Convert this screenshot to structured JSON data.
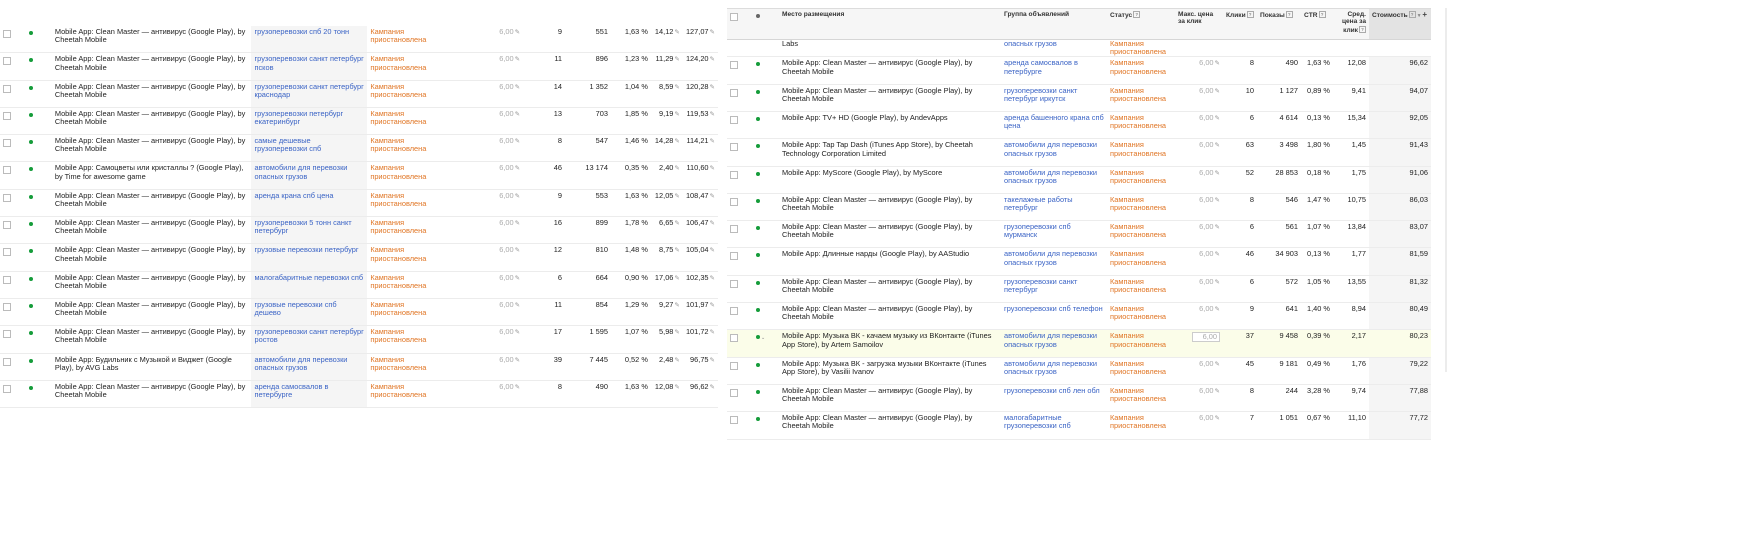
{
  "status_text": "Кампания приостановлена",
  "bid_value": "6,00",
  "right_headers": {
    "placement": "Место размещения",
    "ad_group": "Группа объявлений",
    "status": "Статус",
    "max_cpc": "Макс. цена за клик",
    "clicks": "Клики",
    "impressions": "Показы",
    "ctr": "CTR",
    "avg_cpc": "Сред. цена за клик",
    "cost": "Стоимость"
  },
  "right_partial_row": {
    "placement": "Labs",
    "ad_group": "опасных грузов"
  },
  "left_rows": [
    {
      "placement": "Mobile App: Clean Master — антивирус (Google Play), by Cheetah Mobile",
      "ad_group": "грузоперевозки спб 20 тонн",
      "clicks": "9",
      "impressions": "551",
      "ctr": "1,63 %",
      "avg_cpc": "14,12",
      "cost": "127,07"
    },
    {
      "placement": "Mobile App: Clean Master — антивирус (Google Play), by Cheetah Mobile",
      "ad_group": "грузоперевозки санкт петербург псков",
      "clicks": "11",
      "impressions": "896",
      "ctr": "1,23 %",
      "avg_cpc": "11,29",
      "cost": "124,20"
    },
    {
      "placement": "Mobile App: Clean Master — антивирус (Google Play), by Cheetah Mobile",
      "ad_group": "грузоперевозки санкт петербург краснодар",
      "clicks": "14",
      "impressions": "1 352",
      "ctr": "1,04 %",
      "avg_cpc": "8,59",
      "cost": "120,28"
    },
    {
      "placement": "Mobile App: Clean Master — антивирус (Google Play), by Cheetah Mobile",
      "ad_group": "грузоперевозки петербург екатеринбург",
      "clicks": "13",
      "impressions": "703",
      "ctr": "1,85 %",
      "avg_cpc": "9,19",
      "cost": "119,53"
    },
    {
      "placement": "Mobile App: Clean Master — антивирус (Google Play), by Cheetah Mobile",
      "ad_group": "самые дешевые грузоперевозки спб",
      "clicks": "8",
      "impressions": "547",
      "ctr": "1,46 %",
      "avg_cpc": "14,28",
      "cost": "114,21"
    },
    {
      "placement": "Mobile App: Самоцветы или кристаллы ? (Google Play), by Time for awesome game",
      "ad_group": "автомобили для перевозки опасных грузов",
      "clicks": "46",
      "impressions": "13 174",
      "ctr": "0,35 %",
      "avg_cpc": "2,40",
      "cost": "110,60"
    },
    {
      "placement": "Mobile App: Clean Master — антивирус (Google Play), by Cheetah Mobile",
      "ad_group": "аренда крана спб цена",
      "clicks": "9",
      "impressions": "553",
      "ctr": "1,63 %",
      "avg_cpc": "12,05",
      "cost": "108,47"
    },
    {
      "placement": "Mobile App: Clean Master — антивирус (Google Play), by Cheetah Mobile",
      "ad_group": "грузоперевозки 5 тонн санкт петербург",
      "clicks": "16",
      "impressions": "899",
      "ctr": "1,78 %",
      "avg_cpc": "6,65",
      "cost": "106,47"
    },
    {
      "placement": "Mobile App: Clean Master — антивирус (Google Play), by Cheetah Mobile",
      "ad_group": "грузовые перевозки петербург",
      "clicks": "12",
      "impressions": "810",
      "ctr": "1,48 %",
      "avg_cpc": "8,75",
      "cost": "105,04"
    },
    {
      "placement": "Mobile App: Clean Master — антивирус (Google Play), by Cheetah Mobile",
      "ad_group": "малогабаритные перевозки спб",
      "clicks": "6",
      "impressions": "664",
      "ctr": "0,90 %",
      "avg_cpc": "17,06",
      "cost": "102,35"
    },
    {
      "placement": "Mobile App: Clean Master — антивирус (Google Play), by Cheetah Mobile",
      "ad_group": "грузовые перевозки спб дешево",
      "clicks": "11",
      "impressions": "854",
      "ctr": "1,29 %",
      "avg_cpc": "9,27",
      "cost": "101,97"
    },
    {
      "placement": "Mobile App: Clean Master — антивирус (Google Play), by Cheetah Mobile",
      "ad_group": "грузоперевозки санкт петербург ростов",
      "clicks": "17",
      "impressions": "1 595",
      "ctr": "1,07 %",
      "avg_cpc": "5,98",
      "cost": "101,72"
    },
    {
      "placement": "Mobile App: Будильник с Музыкой и Виджет (Google Play), by AVG Labs",
      "ad_group": "автомобили для перевозки опасных грузов",
      "clicks": "39",
      "impressions": "7 445",
      "ctr": "0,52 %",
      "avg_cpc": "2,48",
      "cost": "96,75"
    },
    {
      "placement": "Mobile App: Clean Master — антивирус (Google Play), by Cheetah Mobile",
      "ad_group": "аренда самосвалов в петербурге",
      "clicks": "8",
      "impressions": "490",
      "ctr": "1,63 %",
      "avg_cpc": "12,08",
      "cost": "96,62"
    }
  ],
  "right_rows": [
    {
      "placement": "Mobile App: Clean Master — антивирус (Google Play), by Cheetah Mobile",
      "ad_group": "аренда самосвалов в петербурге",
      "clicks": "8",
      "impressions": "490",
      "ctr": "1,63 %",
      "avg_cpc": "12,08",
      "cost": "96,62"
    },
    {
      "placement": "Mobile App: Clean Master — антивирус (Google Play), by Cheetah Mobile",
      "ad_group": "грузоперевозки санкт петербург иркутск",
      "clicks": "10",
      "impressions": "1 127",
      "ctr": "0,89 %",
      "avg_cpc": "9,41",
      "cost": "94,07"
    },
    {
      "placement": "Mobile App: TV+ HD (Google Play), by AndevApps",
      "ad_group": "аренда башенного крана спб цена",
      "clicks": "6",
      "impressions": "4 614",
      "ctr": "0,13 %",
      "avg_cpc": "15,34",
      "cost": "92,05"
    },
    {
      "placement": "Mobile App: Tap Tap Dash (iTunes App Store), by Cheetah Technology Corporation Limited",
      "ad_group": "автомобили для перевозки опасных грузов",
      "clicks": "63",
      "impressions": "3 498",
      "ctr": "1,80 %",
      "avg_cpc": "1,45",
      "cost": "91,43"
    },
    {
      "placement": "Mobile App: MyScore (Google Play), by MyScore",
      "ad_group": "автомобили для перевозки опасных грузов",
      "clicks": "52",
      "impressions": "28 853",
      "ctr": "0,18 %",
      "avg_cpc": "1,75",
      "cost": "91,06"
    },
    {
      "placement": "Mobile App: Clean Master — антивирус (Google Play), by Cheetah Mobile",
      "ad_group": "такелажные работы петербург",
      "clicks": "8",
      "impressions": "546",
      "ctr": "1,47 %",
      "avg_cpc": "10,75",
      "cost": "86,03"
    },
    {
      "placement": "Mobile App: Clean Master — антивирус (Google Play), by Cheetah Mobile",
      "ad_group": "грузоперевозки спб мурманск",
      "clicks": "6",
      "impressions": "561",
      "ctr": "1,07 %",
      "avg_cpc": "13,84",
      "cost": "83,07"
    },
    {
      "placement": "Mobile App: Длинные нарды (Google Play), by AAStudio",
      "ad_group": "автомобили для перевозки опасных грузов",
      "clicks": "46",
      "impressions": "34 903",
      "ctr": "0,13 %",
      "avg_cpc": "1,77",
      "cost": "81,59"
    },
    {
      "placement": "Mobile App: Clean Master — антивирус (Google Play), by Cheetah Mobile",
      "ad_group": "грузоперевозки санкт петербург",
      "clicks": "6",
      "impressions": "572",
      "ctr": "1,05 %",
      "avg_cpc": "13,55",
      "cost": "81,32"
    },
    {
      "placement": "Mobile App: Clean Master — антивирус (Google Play), by Cheetah Mobile",
      "ad_group": "грузоперевозки спб телефон",
      "clicks": "9",
      "impressions": "641",
      "ctr": "1,40 %",
      "avg_cpc": "8,94",
      "cost": "80,49"
    },
    {
      "placement": "Mobile App: Музыка ВК - качаем музыку из ВКонтакте (iTunes App Store), by Artem Samoilov",
      "ad_group": "автомобили для перевозки опасных грузов",
      "clicks": "37",
      "impressions": "9 458",
      "ctr": "0,39 %",
      "avg_cpc": "2,17",
      "cost": "80,23",
      "highlight": true
    },
    {
      "placement": "Mobile App: Музыка ВК - загрузка музыки ВКонтакте (iTunes App Store), by Vasilii Ivanov",
      "ad_group": "автомобили для перевозки опасных грузов",
      "clicks": "45",
      "impressions": "9 181",
      "ctr": "0,49 %",
      "avg_cpc": "1,76",
      "cost": "79,22"
    },
    {
      "placement": "Mobile App: Clean Master — антивирус (Google Play), by Cheetah Mobile",
      "ad_group": "грузоперевозки спб лен обл",
      "clicks": "8",
      "impressions": "244",
      "ctr": "3,28 %",
      "avg_cpc": "9,74",
      "cost": "77,88"
    },
    {
      "placement": "Mobile App: Clean Master — антивирус (Google Play), by Cheetah Mobile",
      "ad_group": "малогабаритные грузоперевозки спб",
      "clicks": "7",
      "impressions": "1 051",
      "ctr": "0,67 %",
      "avg_cpc": "11,10",
      "cost": "77,72"
    }
  ]
}
